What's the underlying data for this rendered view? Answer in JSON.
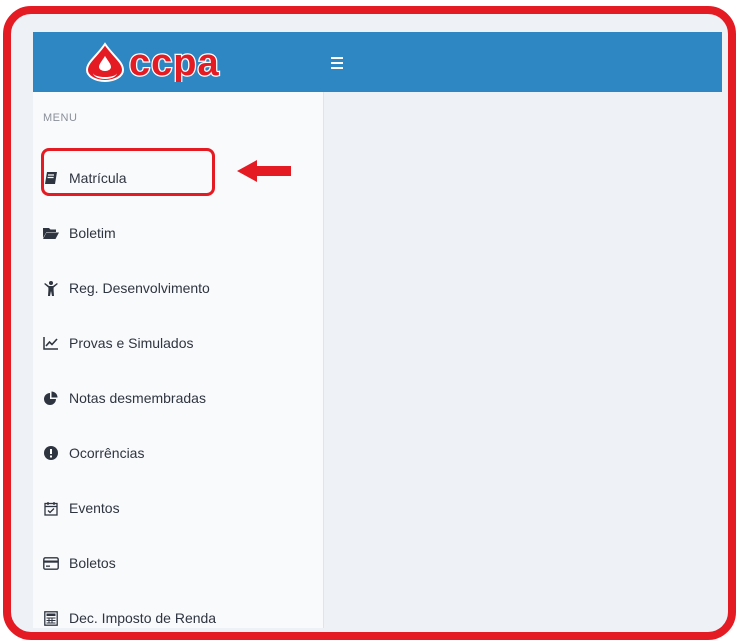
{
  "brand": {
    "name": "ccpa",
    "color": "#e51b24"
  },
  "topbar": {
    "menu_toggle_icon": "hamburger-icon",
    "color": "#2e87c3"
  },
  "sidebar": {
    "header": "MENU",
    "items": [
      {
        "label": "Matrícula",
        "icon": "book-icon"
      },
      {
        "label": "Boletim",
        "icon": "folder-open-icon"
      },
      {
        "label": "Reg. Desenvolvimento",
        "icon": "child-icon"
      },
      {
        "label": "Provas e Simulados",
        "icon": "line-chart-icon"
      },
      {
        "label": "Notas desmembradas",
        "icon": "pie-chart-icon"
      },
      {
        "label": "Ocorrências",
        "icon": "exclamation-circle-icon"
      },
      {
        "label": "Eventos",
        "icon": "calendar-check-icon"
      },
      {
        "label": "Boletos",
        "icon": "credit-card-icon"
      },
      {
        "label": "Dec. Imposto de Renda",
        "icon": "calculator-icon"
      }
    ]
  },
  "annotation": {
    "highlight_color": "#e51b24",
    "target": "Matrícula"
  }
}
